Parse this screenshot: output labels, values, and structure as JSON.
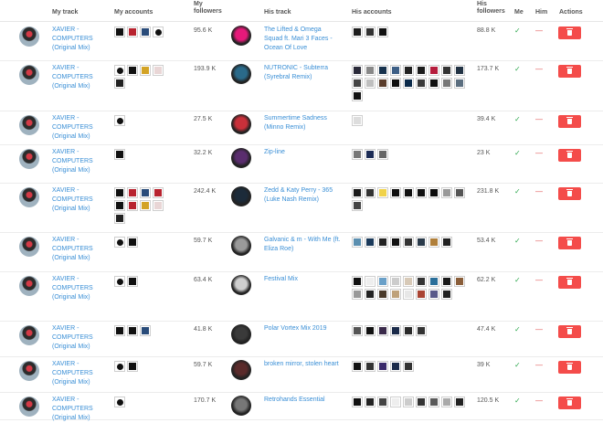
{
  "headers": {
    "my_track": "My track",
    "my_accounts": "My accounts",
    "my_followers": "My\nfollowers",
    "his_track": "His track",
    "his_accounts": "His accounts",
    "his_followers": "His\nfollowers",
    "me": "Me",
    "him": "Him",
    "actions": "Actions"
  },
  "rows": [
    {
      "my_track": "XAVIER - COMPUTERS (Original Mix)",
      "my_accounts": [
        "#111",
        "#b8232f",
        "#2a4c7a",
        "c"
      ],
      "my_followers": "95.6 K",
      "his_track": "The Lifted & Omega Squad ft. Mari 3 Faces - Ocean Of Love",
      "his_art": "#e6197a",
      "his_accounts": [
        "#1e1e1e",
        "#333",
        "#111"
      ],
      "his_followers": "88.8 K",
      "me": "✓",
      "him": "—"
    },
    {
      "my_track": "XAVIER - COMPUTERS (Original Mix)",
      "my_accounts": [
        "c",
        "#111",
        "#d3a325",
        "#e9d6d6",
        "#222"
      ],
      "my_followers": "193.9 K",
      "his_track": "NUTRONIC - Subterra (Syrebral Remix)",
      "his_art": "#2a6a8a",
      "his_accounts": [
        "#2b2b3a",
        "#888",
        "#17324d",
        "#3d5f86",
        "#222",
        "#1a1a1a",
        "#b51c3c",
        "#333",
        "#223344",
        "#444",
        "#bfbfbf",
        "#5a3d2b",
        "#0f0f0f",
        "#0b2a4a",
        "#3a3a3a",
        "#111",
        "#777",
        "#5b6e7f",
        "#111"
      ],
      "his_followers": "173.7 K",
      "me": "✓",
      "him": "—"
    },
    {
      "my_track": "XAVIER - COMPUTERS (Original Mix)",
      "my_accounts": [
        "c"
      ],
      "my_followers": "27.5 K",
      "his_track": "Summertime Sadness (Minno Remix)",
      "his_art": "#c9303a",
      "his_accounts": [
        "#ddd"
      ],
      "his_followers": "39.4 K",
      "me": "✓",
      "him": "—"
    },
    {
      "my_track": "XAVIER - COMPUTERS (Original Mix)",
      "my_accounts": [
        "#111"
      ],
      "my_followers": "32.2 K",
      "his_track": "Zip-line",
      "his_art": "#5a2d6e",
      "his_accounts": [
        "#777",
        "#1b2b55",
        "#666"
      ],
      "his_followers": "23 K",
      "me": "✓",
      "him": "—"
    },
    {
      "my_track": "XAVIER - COMPUTERS (Original Mix)",
      "my_accounts": [
        "#111",
        "#b8232f",
        "#2a4c7a",
        "#b8232f",
        "#111",
        "#b8232f",
        "#d3a325",
        "#e9d6d6",
        "#222"
      ],
      "my_followers": "242.4 K",
      "his_track": "Zedd & Katy Perry - 365 (Luke Nash Remix)",
      "his_art": "#1c2b3a",
      "his_accounts": [
        "#1a1a1a",
        "#333",
        "#f0d24a",
        "#111",
        "#111",
        "#111",
        "#0d0d0d",
        "#999",
        "#555",
        "#444"
      ],
      "his_followers": "231.8 K",
      "me": "✓",
      "him": "—"
    },
    {
      "my_track": "XAVIER - COMPUTERS (Original Mix)",
      "my_accounts": [
        "c",
        "#111"
      ],
      "my_followers": "59.7 K",
      "his_track": "Galvanic & m - With Me (ft. Eliza Roe)",
      "his_art": "#9a9a9a",
      "his_accounts": [
        "#5b8fb0",
        "#1b3a5a",
        "#222",
        "#111",
        "#333",
        "#2a3a4a",
        "#b07f3a",
        "#222"
      ],
      "his_followers": "53.4 K",
      "me": "✓",
      "him": "—"
    },
    {
      "my_track": "XAVIER - COMPUTERS (Original Mix)",
      "my_accounts": [
        "c",
        "#111"
      ],
      "my_followers": "63.4 K",
      "his_track": "Festival Mix",
      "his_art": "#cfcfcf",
      "his_accounts": [
        "#111",
        "#eee",
        "#6aa0c8",
        "#ccc",
        "#d7c9b7",
        "#333",
        "#2b6f9a",
        "#1a1a1a",
        "#8a5e3a",
        "#999",
        "#222",
        "#4a3a2a",
        "#bfa27a",
        "#e7e7e7",
        "#aa4433",
        "#5a5a8a",
        "#222"
      ],
      "his_followers": "62.2 K",
      "me": "✓",
      "him": "—"
    },
    {
      "my_track": "XAVIER - COMPUTERS (Original Mix)",
      "my_accounts": [
        "#111",
        "#111",
        "#2a4c7a"
      ],
      "my_followers": "41.8 K",
      "his_track": "Polar Vortex Mix 2019",
      "his_art": "#3a3a3a",
      "his_accounts": [
        "#555",
        "#111",
        "#3a2a4a",
        "#1b2b4a",
        "#2a2a2a",
        "#333"
      ],
      "his_followers": "47.4 K",
      "me": "✓",
      "him": "—"
    },
    {
      "my_track": "XAVIER - COMPUTERS (Original Mix)",
      "my_accounts": [
        "c",
        "#111"
      ],
      "my_followers": "59.7 K",
      "his_track": "broken mirror, stolen heart",
      "his_art": "#5a2a2a",
      "his_accounts": [
        "#111",
        "#333",
        "#3a2a6a",
        "#1b2b4a",
        "#333"
      ],
      "his_followers": "39 K",
      "me": "✓",
      "him": "—"
    },
    {
      "my_track": "XAVIER - COMPUTERS (Original Mix)",
      "my_accounts": [
        "c"
      ],
      "my_followers": "170.7 K",
      "his_track": "Retrohands Essential",
      "his_art": "#777",
      "his_accounts": [
        "#111",
        "#222",
        "#444",
        "#eee",
        "#ccc",
        "#333",
        "#5a5a5a",
        "#aaa",
        "#222"
      ],
      "his_followers": "120.5 K",
      "me": "✓",
      "him": "—"
    }
  ]
}
